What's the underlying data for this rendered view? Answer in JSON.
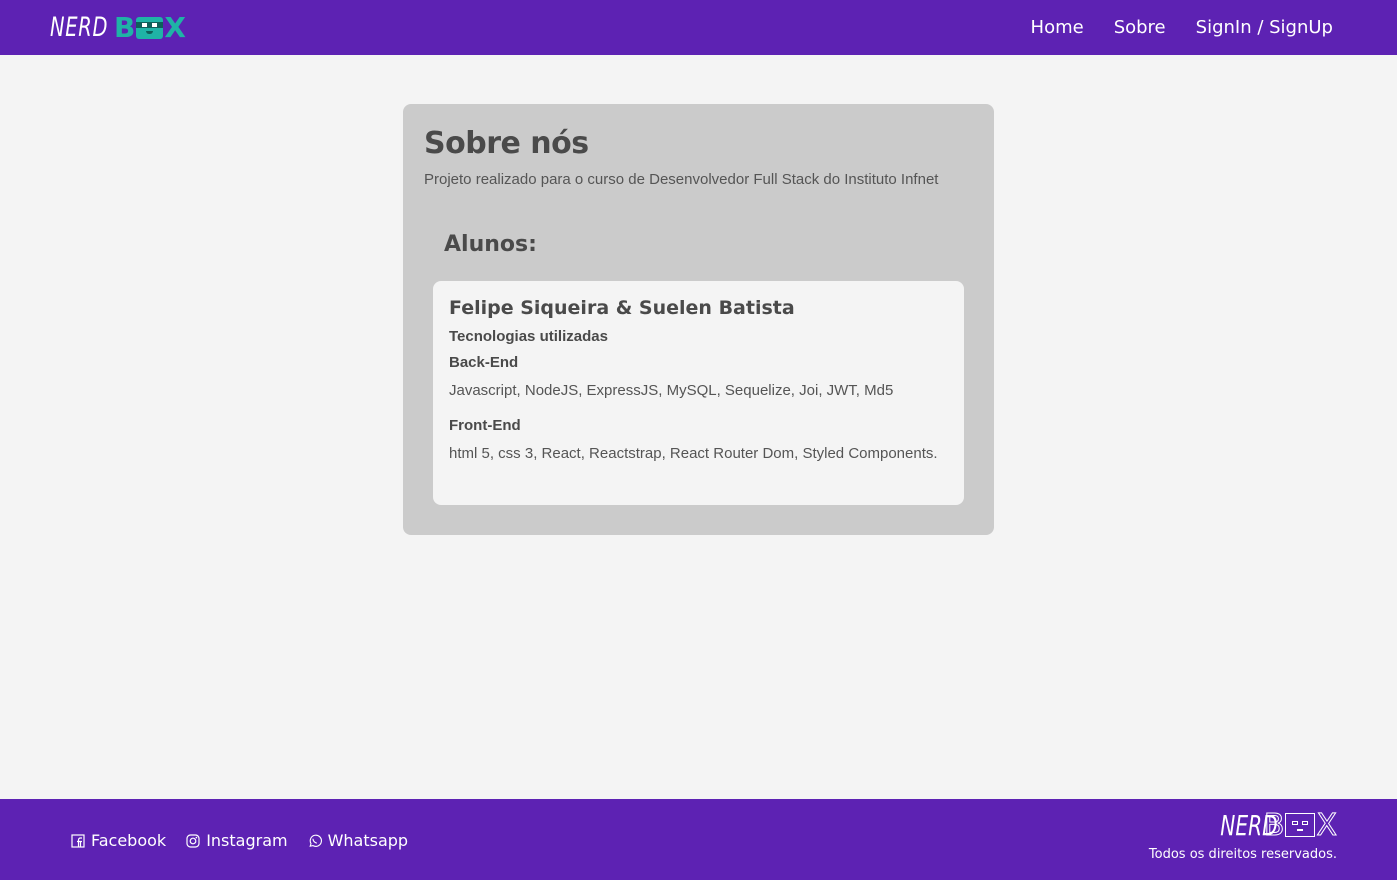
{
  "header": {
    "logo_word_1": "NERD",
    "logo_word_2_start": "B",
    "logo_word_2_end": "X",
    "nav": [
      {
        "label": "Home"
      },
      {
        "label": "Sobre"
      },
      {
        "label": "SignIn / SignUp"
      }
    ]
  },
  "about": {
    "title": "Sobre nós",
    "subtitle": "Projeto realizado para o curso de Desenvolvedor Full Stack do Instituto Infnet",
    "students_heading": "Alunos:",
    "student_card": {
      "names": "Felipe Siqueira & Suelen Batista",
      "tech_heading": "Tecnologias utilizadas",
      "backend_label": "Back-End",
      "backend_text": "Javascript, NodeJS, ExpressJS, MySQL, Sequelize, Joi, JWT, Md5",
      "frontend_label": "Front-End",
      "frontend_text": "html 5, css 3, React, Reactstrap, React Router Dom, Styled Components."
    }
  },
  "footer": {
    "social": [
      {
        "label": "Facebook",
        "icon": "facebook-icon"
      },
      {
        "label": "Instagram",
        "icon": "instagram-icon"
      },
      {
        "label": "Whatsapp",
        "icon": "whatsapp-icon"
      }
    ],
    "logo_word_1": "NERD",
    "logo_word_2_start": "B",
    "logo_word_2_end": "X",
    "rights": "Todos os direitos reservados."
  },
  "colors": {
    "brand_purple": "#5d22b3",
    "brand_teal": "#1fb3a6",
    "card_gray": "#cbcbcb",
    "background": "#f4f4f4"
  }
}
